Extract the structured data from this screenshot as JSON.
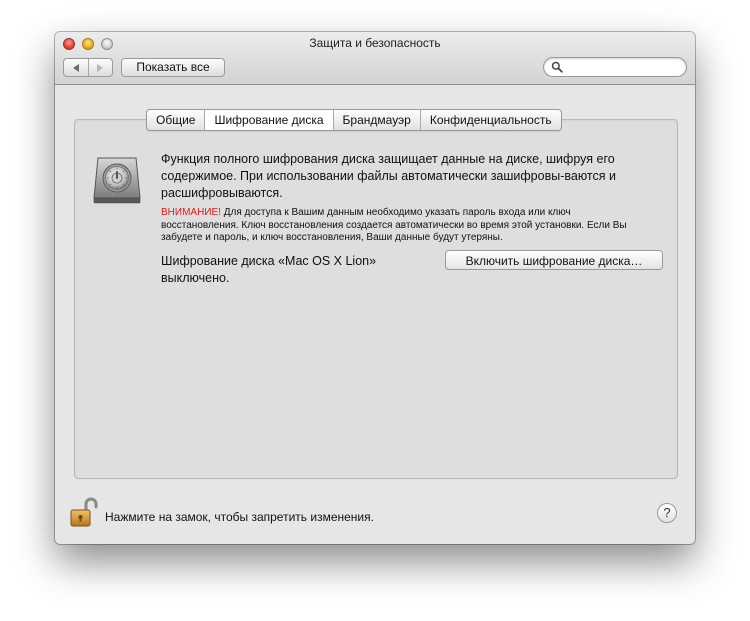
{
  "window": {
    "title": "Защита и безопасность"
  },
  "toolbar": {
    "show_all_label": "Показать все",
    "search_value": "",
    "search_placeholder": ""
  },
  "tabs": [
    {
      "label": "Общие",
      "selected": false
    },
    {
      "label": "Шифрование диска",
      "selected": true
    },
    {
      "label": "Брандмауэр",
      "selected": false
    },
    {
      "label": "Конфиденциальность",
      "selected": false
    }
  ],
  "filevault": {
    "description": "Функция полного шифрования диска защищает данные на диске, шифруя его содержимое. При использовании файлы автоматически зашифровы-ваются и расшифровываются.",
    "warning_label": "ВНИМАНИЕ!",
    "warning_text": " Для доступа к Вашим данным необходимо указать пароль входа или ключ восстановления. Ключ восстановления создается автоматически во время этой установки. Если Вы забудете и пароль, и ключ восстановления, Ваши данные будут утеряны.",
    "status": "Шифрование диска «Mac OS X Lion» выключено.",
    "enable_button": "Включить шифрование диска…"
  },
  "footer": {
    "lock_text": "Нажмите на замок, чтобы запретить изменения.",
    "help_label": "?"
  },
  "colors": {
    "warning": "#e21a1a",
    "window_bg": "#e6e6e6",
    "close": "#e0453a",
    "minimize": "#e7ad25",
    "zoom": "#cfcfcf"
  },
  "icons": [
    "disk-encryption-icon",
    "lock-open-icon",
    "search-icon",
    "back-arrow-icon",
    "forward-arrow-icon"
  ]
}
